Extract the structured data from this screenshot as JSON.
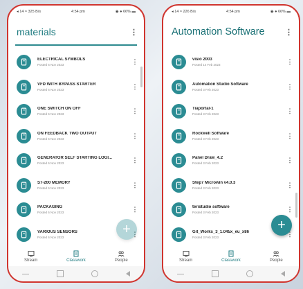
{
  "phones": {
    "left": {
      "status": {
        "left": "◂ 14 ≈ 325 B/s",
        "time": "4:54 pm",
        "right": "◉ ● 66% ▬"
      },
      "title": "materials",
      "items": [
        {
          "title": "ELECTRICAL SYMBOLS",
          "date": "Posted 6 Nov 2023"
        },
        {
          "title": "VFD WITH BYPASS STARTER",
          "date": "Posted 6 Nov 2023"
        },
        {
          "title": "ONE SWITCH ON OFF",
          "date": "Posted 6 Nov 2023"
        },
        {
          "title": "ON FEEDBACK TWO OUTPUT",
          "date": "Posted 6 Nov 2023"
        },
        {
          "title": "GENERATOR SELF STARTING LOGI...",
          "date": "Posted 6 Nov 2023"
        },
        {
          "title": "S7-200 MEMORY",
          "date": "Posted 6 Nov 2023"
        },
        {
          "title": "PACKAGING",
          "date": "Posted 6 Nov 2023"
        },
        {
          "title": "VARIOUS SENSORS",
          "date": "Posted 6 Nov 2023"
        }
      ]
    },
    "right": {
      "status": {
        "left": "◂ 14 ≈ 226 B/s",
        "time": "4:54 pm",
        "right": "◉ ● 66% ▬"
      },
      "title": "Automation Software",
      "items": [
        {
          "title": "visio 2003",
          "date": "Posted 14 Feb 2023"
        },
        {
          "title": "Automation Studio Software",
          "date": "Posted 3 Feb 2023"
        },
        {
          "title": "Tiaportal-1",
          "date": "Posted 3 Feb 2023"
        },
        {
          "title": "Rockwell Software",
          "date": "Posted 3 Feb 2023"
        },
        {
          "title": "Panel Draw_4.2",
          "date": "Posted 3 Feb 2023"
        },
        {
          "title": "Step7 Microwin v4.0.3",
          "date": "Posted 3 Feb 2023"
        },
        {
          "title": "teristudio software",
          "date": "Posted 3 Feb 2023"
        },
        {
          "title": "Git_Works_3_1.045x_eu_x86",
          "date": "Posted 3 Feb 2023"
        }
      ]
    }
  },
  "nav": {
    "stream": "Stream",
    "classwork": "Classwork",
    "people": "People"
  },
  "fab_label": "+",
  "colors": {
    "accent": "#2b8c93",
    "frame": "#d0352f"
  },
  "icons": {
    "item": "document-icon",
    "menu": "more-vert-icon"
  }
}
